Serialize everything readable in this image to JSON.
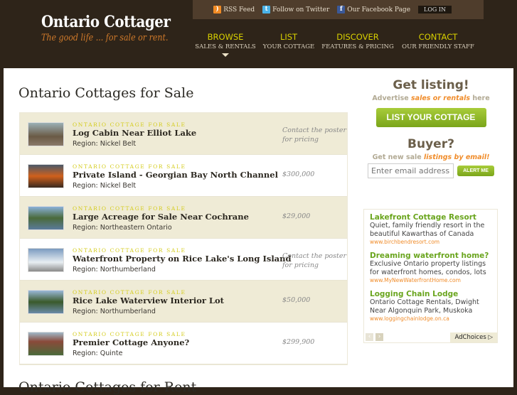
{
  "header": {
    "logo_title": "Ontario Cottager",
    "logo_tagline": "The good life ... for sale or rent.",
    "top_links": [
      "RSS Feed",
      "Follow on Twitter",
      "Our Facebook Page"
    ],
    "login": "LOG IN",
    "nav": [
      {
        "main": "BROWSE",
        "sub": "SALES & RENTALS"
      },
      {
        "main": "LIST",
        "sub": "YOUR COTTAGE"
      },
      {
        "main": "DISCOVER",
        "sub": "FEATURES & PRICING"
      },
      {
        "main": "CONTACT",
        "sub": "OUR FRIENDLY STAFF"
      }
    ]
  },
  "main": {
    "heading": "Ontario Cottages for Sale",
    "rent_heading": "Ontario Cottages for Rent",
    "listings": [
      {
        "category": "ONTARIO COTTAGE FOR SALE",
        "title": "Log Cabin Near Elliot Lake",
        "region": "Region: Nickel Belt",
        "price": "Contact the poster for pricing"
      },
      {
        "category": "ONTARIO COTTAGE FOR SALE",
        "title": "Private Island - Georgian Bay North Channel",
        "region": "Region: Nickel Belt",
        "price": "$300,000"
      },
      {
        "category": "ONTARIO COTTAGE FOR SALE",
        "title": "Large Acreage for Sale Near Cochrane",
        "region": "Region: Northeastern Ontario",
        "price": "$29,000"
      },
      {
        "category": "ONTARIO COTTAGE FOR SALE",
        "title": "Waterfront Property on Rice Lake's Long Island",
        "region": "Region: Northumberland",
        "price": "Contact the poster for pricing"
      },
      {
        "category": "ONTARIO COTTAGE FOR SALE",
        "title": "Rice Lake Waterview Interior Lot",
        "region": "Region: Northumberland",
        "price": "$50,000"
      },
      {
        "category": "ONTARIO COTTAGE FOR SALE",
        "title": "Premier Cottage Anyone?",
        "region": "Region: Quinte",
        "price": "$299,900"
      }
    ]
  },
  "sidebar": {
    "get_listing": "Get listing!",
    "advertise": "Advertise ",
    "adv_em": "sales or rentals",
    "adv_end": " here",
    "list_button": "LIST YOUR COTTAGE",
    "buyer": "Buyer?",
    "new_sale": "Get new sale ",
    "new_sale_em": "listings by email!",
    "email_placeholder": "Enter email address",
    "alert_button": "ALERT ME",
    "ads": [
      {
        "title": "Lakefront Cottage Resort",
        "desc": "Quiet, family friendly resort in the beautiful Kawarthas of Canada",
        "url": "www.birchbendresort.com"
      },
      {
        "title": "Dreaming waterfront home?",
        "desc": "Exclusive Ontario property listings for waterfront homes, condos, lots",
        "url": "www.MyNewWaterfrontHome.com"
      },
      {
        "title": "Logging Chain Lodge",
        "desc": "Ontario Cottage Rentals, Dwight Near Algonquin Park, Muskoka",
        "url": "www.loggingchainlodge.on.ca"
      }
    ],
    "adchoices": "AdChoices"
  }
}
